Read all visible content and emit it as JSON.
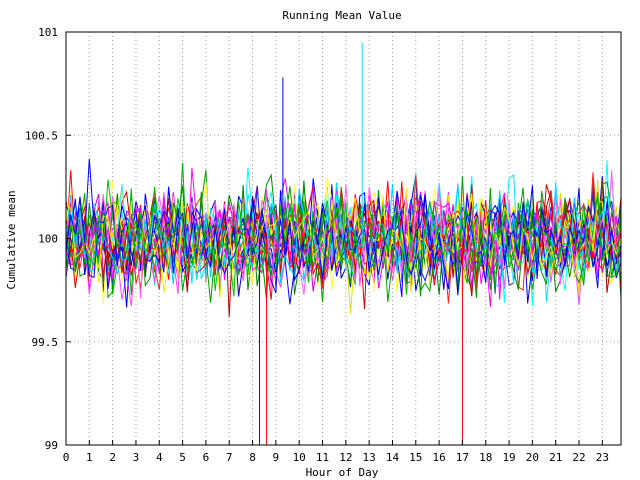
{
  "chart_data": {
    "type": "line",
    "title": "Running Mean Value",
    "xlabel": "Hour of Day",
    "ylabel": "Cumulative mean",
    "xlim": [
      0,
      23.8
    ],
    "ylim": [
      99,
      101
    ],
    "x_ticks": [
      "0",
      "1",
      "2",
      "3",
      "4",
      "5",
      "6",
      "7",
      "8",
      "9",
      "10",
      "11",
      "12",
      "13",
      "14",
      "15",
      "16",
      "17",
      "18",
      "19",
      "20",
      "21",
      "22",
      "23"
    ],
    "y_ticks": [
      "99",
      "99.5",
      "100",
      "100.5",
      "101"
    ],
    "grid": true,
    "legend": "none",
    "series_colors": [
      "#0000ff",
      "#00a000",
      "#ff0000",
      "#ff00ff",
      "#00e5ff",
      "#ffff00",
      "#0000c0",
      "#008000",
      "#c00000",
      "#ff40ff",
      "#00ffff",
      "#e0e000",
      "#2020ff",
      "#00b000",
      "#ff2020",
      "#d000d0",
      "#40e0ff",
      "#ffff40",
      "#0000ff",
      "#009000",
      "#ff0000",
      "#ff00ff",
      "#0000e0",
      "#00a000",
      "#e00000",
      "#ff60ff",
      "#00d0ff",
      "#f0f000",
      "#0000ff",
      "#00c000"
    ],
    "series_count": 30,
    "points_per_series": 120,
    "mean": 100,
    "series": [],
    "spikes": [
      {
        "x": 8.3,
        "y": 99.0,
        "color": "#0000ff"
      },
      {
        "x": 8.6,
        "y": 99.0,
        "color": "#ff0000"
      },
      {
        "x": 12.7,
        "y": 100.95,
        "color": "#00e5ff"
      },
      {
        "x": 17.0,
        "y": 99.0,
        "color": "#ff0000"
      },
      {
        "x": 9.3,
        "y": 100.78,
        "color": "#0000ff"
      }
    ]
  }
}
